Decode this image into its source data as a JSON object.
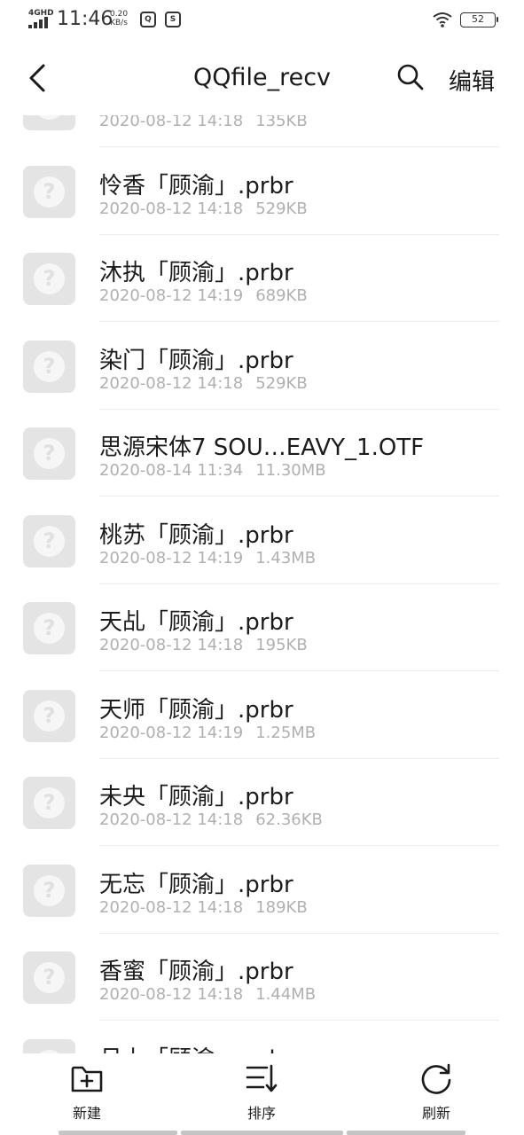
{
  "status_bar": {
    "network": "4GHD",
    "time": "11:46",
    "speed_value": "0.20",
    "speed_unit": "KB/s",
    "battery": "52"
  },
  "header": {
    "title": "QQfile_recv",
    "edit_label": "编辑",
    "back_icon": "chevron-left-icon",
    "search_icon": "search-icon"
  },
  "files": [
    {
      "name": "",
      "date": "2020-08-12 14:18",
      "size": "135KB"
    },
    {
      "name": "怜香「顾渝」.prbr",
      "date": "2020-08-12 14:18",
      "size": "529KB"
    },
    {
      "name": "沐执「顾渝」.prbr",
      "date": "2020-08-12 14:19",
      "size": "689KB"
    },
    {
      "name": "染门「顾渝」.prbr",
      "date": "2020-08-12 14:18",
      "size": "529KB"
    },
    {
      "name": "思源宋体7 SOU…EAVY_1.OTF",
      "date": "2020-08-14 11:34",
      "size": "11.30MB"
    },
    {
      "name": "桃苏「顾渝」.prbr",
      "date": "2020-08-12 14:19",
      "size": "1.43MB"
    },
    {
      "name": "天乩「顾渝」.prbr",
      "date": "2020-08-12 14:18",
      "size": "195KB"
    },
    {
      "name": "天师「顾渝」.prbr",
      "date": "2020-08-12 14:19",
      "size": "1.25MB"
    },
    {
      "name": "未央「顾渝」.prbr",
      "date": "2020-08-12 14:18",
      "size": "62.36KB"
    },
    {
      "name": "无忘「顾渝」.prbr",
      "date": "2020-08-12 14:18",
      "size": "189KB"
    },
    {
      "name": "香蜜「顾渝」.prbr",
      "date": "2020-08-12 14:18",
      "size": "1.44MB"
    },
    {
      "name": "月上「顾渝」.prbr",
      "date": "",
      "size": ""
    }
  ],
  "bottom_bar": {
    "new_label": "新建",
    "sort_label": "排序",
    "refresh_label": "刷新"
  }
}
